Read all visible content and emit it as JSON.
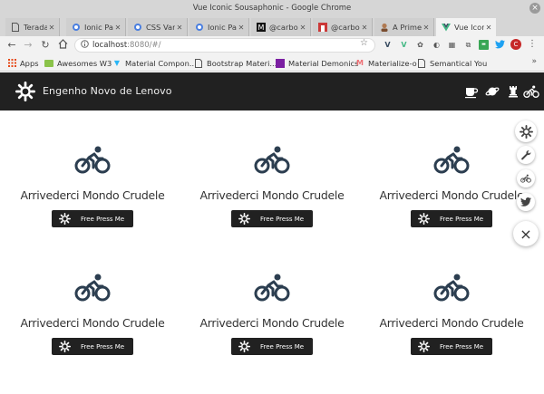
{
  "window": {
    "title": "Vue Iconic Sousaphonic - Google Chrome"
  },
  "tabs": [
    {
      "label": "Teradata",
      "icon": "page-icon"
    },
    {
      "label": "Ionic Pa",
      "icon": "globe-icon"
    },
    {
      "label": "CSS Vari",
      "icon": "globe-icon"
    },
    {
      "label": "Ionic Pa",
      "icon": "page-icon"
    },
    {
      "label": "@carbon",
      "icon": "medium-icon"
    },
    {
      "label": "@carbon",
      "icon": "npm-icon"
    },
    {
      "label": "A Primer",
      "icon": "person-icon"
    },
    {
      "label": "Vue Icon",
      "icon": "vue-icon"
    }
  ],
  "address": {
    "host": "localhost",
    "rest": ":8080/#/"
  },
  "bookmarks": [
    {
      "label": "Apps",
      "icon": "apps-grid-icon"
    },
    {
      "label": "Awesomes W3",
      "icon": "green-badge-icon"
    },
    {
      "label": "Material Compon...",
      "icon": "pin-icon"
    },
    {
      "label": "Bootstrap Materi...",
      "icon": "page-icon"
    },
    {
      "label": "Material Demonics",
      "icon": "purple-square-icon"
    },
    {
      "label": "Materialize-o",
      "icon": "materialize-icon"
    },
    {
      "label": "Semantical You",
      "icon": "page-icon"
    }
  ],
  "avatar_letter": "C",
  "app": {
    "title": "Engenho Novo de Lenovo",
    "actions": [
      "coffee-icon",
      "planet-icon",
      "chess-rook-icon",
      "bicycle-icon"
    ]
  },
  "cards": [
    {
      "title": "Arrivederci Mondo Crudele",
      "button": "Free Press Me"
    },
    {
      "title": "Arrivederci Mondo Crudele",
      "button": "Free Press Me"
    },
    {
      "title": "Arrivederci Mondo Crudele",
      "button": "Free Press Me"
    },
    {
      "title": "Arrivederci Mondo Crudele",
      "button": "Free Press Me"
    },
    {
      "title": "Arrivederci Mondo Crudele",
      "button": "Free Press Me"
    },
    {
      "title": "Arrivederci Mondo Crudele",
      "button": "Free Press Me"
    }
  ],
  "fab": {
    "main": "×",
    "items": [
      "gear-icon",
      "wrench-icon",
      "bicycle-icon",
      "twitter-icon"
    ]
  },
  "colors": {
    "appbar": "#212121",
    "icon": "#2c3e50",
    "accent_vue": "#41b883"
  }
}
